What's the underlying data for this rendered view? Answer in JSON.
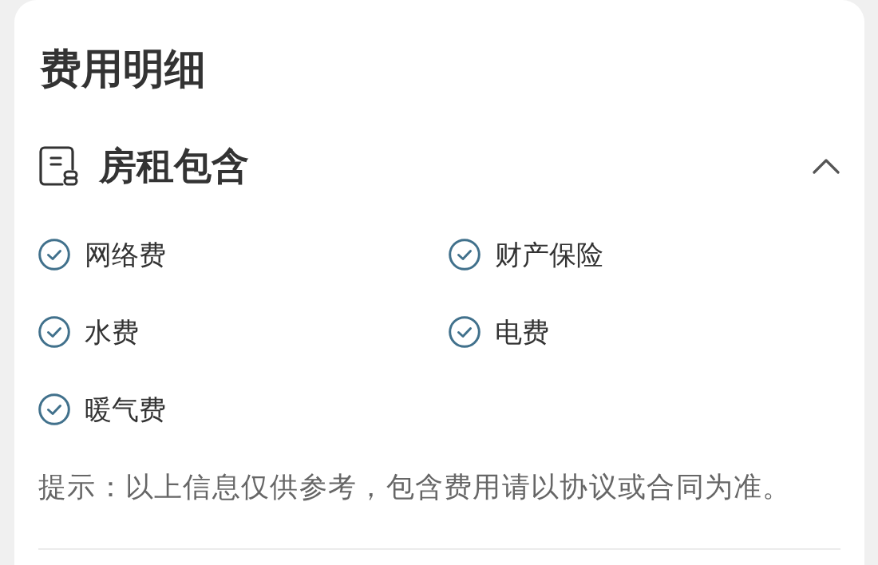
{
  "title": "费用明细",
  "section": {
    "title": "房租包含",
    "expanded": true,
    "items": [
      {
        "label": "网络费",
        "checked": true
      },
      {
        "label": "财产保险",
        "checked": true
      },
      {
        "label": "水费",
        "checked": true
      },
      {
        "label": "电费",
        "checked": true
      },
      {
        "label": "暖气费",
        "checked": true
      }
    ],
    "hint": "提示：以上信息仅供参考，包含费用请以协议或合同为准。"
  }
}
